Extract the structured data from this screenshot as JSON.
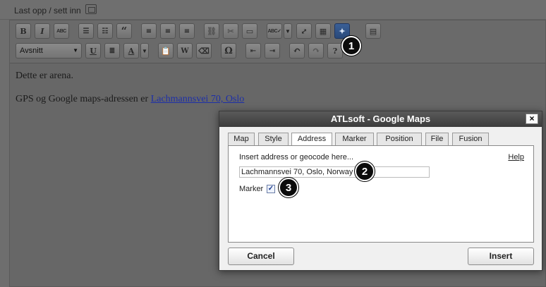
{
  "topbar": {
    "upload_label": "Last opp / sett inn"
  },
  "toolbar": {
    "format_value": "Avsnitt"
  },
  "content": {
    "line1": "Dette er arena.",
    "line2_prefix": "GPS og Google maps-adressen er ",
    "line2_link": "Lachmannsvei 70, Oslo"
  },
  "dialog": {
    "title": "ATLsoft - Google Maps",
    "close": "×",
    "tabs": [
      "Map",
      "Style",
      "Address",
      "Marker",
      "Position",
      "File",
      "Fusion"
    ],
    "selected_tab": "Address",
    "prompt": "Insert address or geocode here...",
    "help": "Help",
    "address_value": "Lachmannsvei 70, Oslo, Norway",
    "marker_label": "Marker",
    "marker_checked": true,
    "cancel": "Cancel",
    "insert": "Insert"
  },
  "callouts": [
    "1",
    "2",
    "3"
  ]
}
